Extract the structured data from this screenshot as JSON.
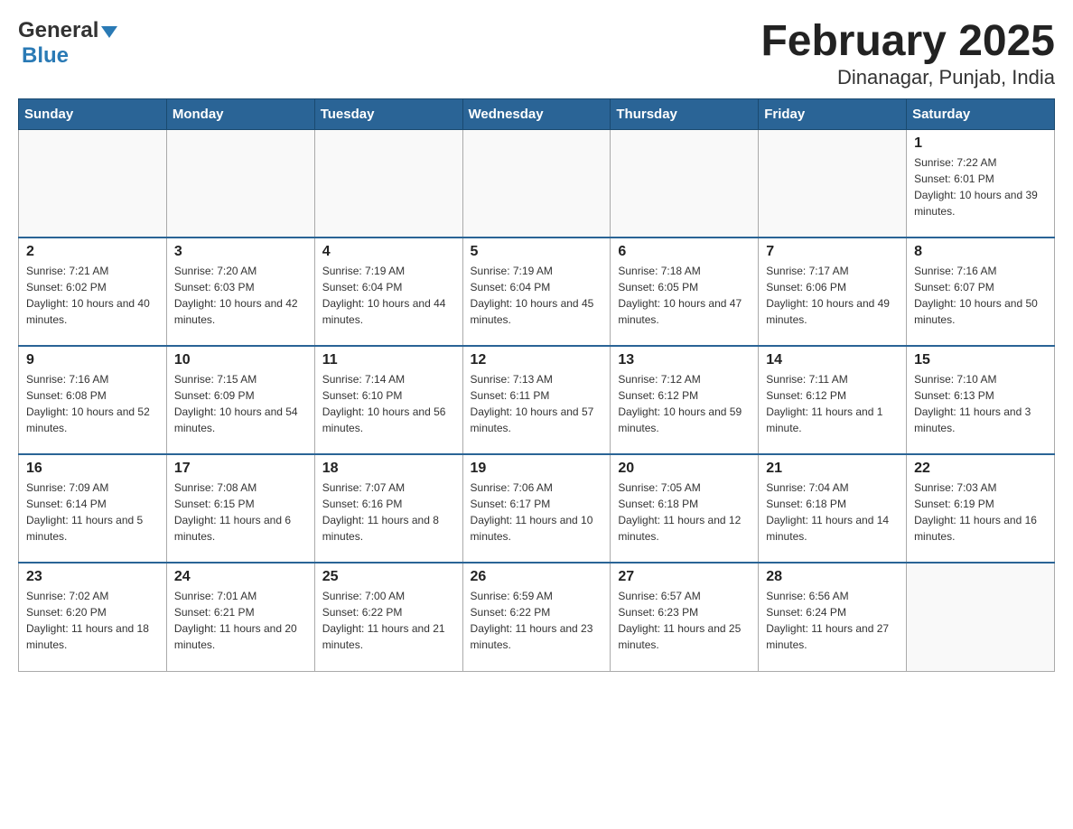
{
  "header": {
    "logo_general": "General",
    "logo_blue": "Blue",
    "title": "February 2025",
    "subtitle": "Dinanagar, Punjab, India"
  },
  "weekdays": [
    "Sunday",
    "Monday",
    "Tuesday",
    "Wednesday",
    "Thursday",
    "Friday",
    "Saturday"
  ],
  "weeks": [
    [
      {
        "day": "",
        "sunrise": "",
        "sunset": "",
        "daylight": ""
      },
      {
        "day": "",
        "sunrise": "",
        "sunset": "",
        "daylight": ""
      },
      {
        "day": "",
        "sunrise": "",
        "sunset": "",
        "daylight": ""
      },
      {
        "day": "",
        "sunrise": "",
        "sunset": "",
        "daylight": ""
      },
      {
        "day": "",
        "sunrise": "",
        "sunset": "",
        "daylight": ""
      },
      {
        "day": "",
        "sunrise": "",
        "sunset": "",
        "daylight": ""
      },
      {
        "day": "1",
        "sunrise": "Sunrise: 7:22 AM",
        "sunset": "Sunset: 6:01 PM",
        "daylight": "Daylight: 10 hours and 39 minutes."
      }
    ],
    [
      {
        "day": "2",
        "sunrise": "Sunrise: 7:21 AM",
        "sunset": "Sunset: 6:02 PM",
        "daylight": "Daylight: 10 hours and 40 minutes."
      },
      {
        "day": "3",
        "sunrise": "Sunrise: 7:20 AM",
        "sunset": "Sunset: 6:03 PM",
        "daylight": "Daylight: 10 hours and 42 minutes."
      },
      {
        "day": "4",
        "sunrise": "Sunrise: 7:19 AM",
        "sunset": "Sunset: 6:04 PM",
        "daylight": "Daylight: 10 hours and 44 minutes."
      },
      {
        "day": "5",
        "sunrise": "Sunrise: 7:19 AM",
        "sunset": "Sunset: 6:04 PM",
        "daylight": "Daylight: 10 hours and 45 minutes."
      },
      {
        "day": "6",
        "sunrise": "Sunrise: 7:18 AM",
        "sunset": "Sunset: 6:05 PM",
        "daylight": "Daylight: 10 hours and 47 minutes."
      },
      {
        "day": "7",
        "sunrise": "Sunrise: 7:17 AM",
        "sunset": "Sunset: 6:06 PM",
        "daylight": "Daylight: 10 hours and 49 minutes."
      },
      {
        "day": "8",
        "sunrise": "Sunrise: 7:16 AM",
        "sunset": "Sunset: 6:07 PM",
        "daylight": "Daylight: 10 hours and 50 minutes."
      }
    ],
    [
      {
        "day": "9",
        "sunrise": "Sunrise: 7:16 AM",
        "sunset": "Sunset: 6:08 PM",
        "daylight": "Daylight: 10 hours and 52 minutes."
      },
      {
        "day": "10",
        "sunrise": "Sunrise: 7:15 AM",
        "sunset": "Sunset: 6:09 PM",
        "daylight": "Daylight: 10 hours and 54 minutes."
      },
      {
        "day": "11",
        "sunrise": "Sunrise: 7:14 AM",
        "sunset": "Sunset: 6:10 PM",
        "daylight": "Daylight: 10 hours and 56 minutes."
      },
      {
        "day": "12",
        "sunrise": "Sunrise: 7:13 AM",
        "sunset": "Sunset: 6:11 PM",
        "daylight": "Daylight: 10 hours and 57 minutes."
      },
      {
        "day": "13",
        "sunrise": "Sunrise: 7:12 AM",
        "sunset": "Sunset: 6:12 PM",
        "daylight": "Daylight: 10 hours and 59 minutes."
      },
      {
        "day": "14",
        "sunrise": "Sunrise: 7:11 AM",
        "sunset": "Sunset: 6:12 PM",
        "daylight": "Daylight: 11 hours and 1 minute."
      },
      {
        "day": "15",
        "sunrise": "Sunrise: 7:10 AM",
        "sunset": "Sunset: 6:13 PM",
        "daylight": "Daylight: 11 hours and 3 minutes."
      }
    ],
    [
      {
        "day": "16",
        "sunrise": "Sunrise: 7:09 AM",
        "sunset": "Sunset: 6:14 PM",
        "daylight": "Daylight: 11 hours and 5 minutes."
      },
      {
        "day": "17",
        "sunrise": "Sunrise: 7:08 AM",
        "sunset": "Sunset: 6:15 PM",
        "daylight": "Daylight: 11 hours and 6 minutes."
      },
      {
        "day": "18",
        "sunrise": "Sunrise: 7:07 AM",
        "sunset": "Sunset: 6:16 PM",
        "daylight": "Daylight: 11 hours and 8 minutes."
      },
      {
        "day": "19",
        "sunrise": "Sunrise: 7:06 AM",
        "sunset": "Sunset: 6:17 PM",
        "daylight": "Daylight: 11 hours and 10 minutes."
      },
      {
        "day": "20",
        "sunrise": "Sunrise: 7:05 AM",
        "sunset": "Sunset: 6:18 PM",
        "daylight": "Daylight: 11 hours and 12 minutes."
      },
      {
        "day": "21",
        "sunrise": "Sunrise: 7:04 AM",
        "sunset": "Sunset: 6:18 PM",
        "daylight": "Daylight: 11 hours and 14 minutes."
      },
      {
        "day": "22",
        "sunrise": "Sunrise: 7:03 AM",
        "sunset": "Sunset: 6:19 PM",
        "daylight": "Daylight: 11 hours and 16 minutes."
      }
    ],
    [
      {
        "day": "23",
        "sunrise": "Sunrise: 7:02 AM",
        "sunset": "Sunset: 6:20 PM",
        "daylight": "Daylight: 11 hours and 18 minutes."
      },
      {
        "day": "24",
        "sunrise": "Sunrise: 7:01 AM",
        "sunset": "Sunset: 6:21 PM",
        "daylight": "Daylight: 11 hours and 20 minutes."
      },
      {
        "day": "25",
        "sunrise": "Sunrise: 7:00 AM",
        "sunset": "Sunset: 6:22 PM",
        "daylight": "Daylight: 11 hours and 21 minutes."
      },
      {
        "day": "26",
        "sunrise": "Sunrise: 6:59 AM",
        "sunset": "Sunset: 6:22 PM",
        "daylight": "Daylight: 11 hours and 23 minutes."
      },
      {
        "day": "27",
        "sunrise": "Sunrise: 6:57 AM",
        "sunset": "Sunset: 6:23 PM",
        "daylight": "Daylight: 11 hours and 25 minutes."
      },
      {
        "day": "28",
        "sunrise": "Sunrise: 6:56 AM",
        "sunset": "Sunset: 6:24 PM",
        "daylight": "Daylight: 11 hours and 27 minutes."
      },
      {
        "day": "",
        "sunrise": "",
        "sunset": "",
        "daylight": ""
      }
    ]
  ]
}
